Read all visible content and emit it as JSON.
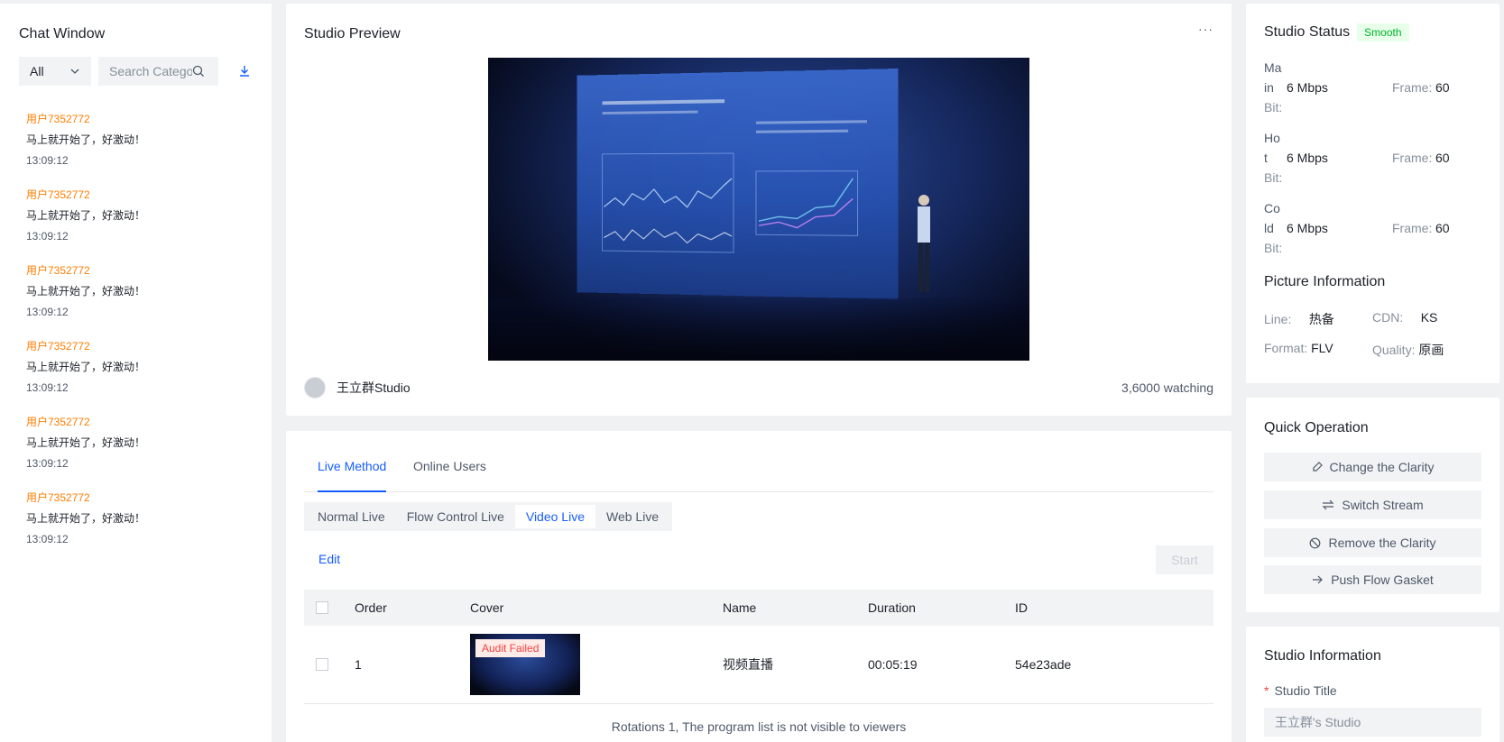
{
  "chat": {
    "title": "Chat Window",
    "filter_value": "All",
    "search_placeholder": "Search Category",
    "messages": [
      {
        "user": "用户7352772",
        "text": "马上就开始了，好激动！",
        "time": "13:09:12"
      },
      {
        "user": "用户7352772",
        "text": "马上就开始了，好激动！",
        "time": "13:09:12"
      },
      {
        "user": "用户7352772",
        "text": "马上就开始了，好激动！",
        "time": "13:09:12"
      },
      {
        "user": "用户7352772",
        "text": "马上就开始了，好激动！",
        "time": "13:09:12"
      },
      {
        "user": "用户7352772",
        "text": "马上就开始了，好激动！",
        "time": "13:09:12"
      },
      {
        "user": "用户7352772",
        "text": "马上就开始了，好激动！",
        "time": "13:09:12"
      }
    ]
  },
  "preview": {
    "title": "Studio Preview",
    "more": "···",
    "streamer_name": "王立群Studio",
    "watching": "3,6000 watching"
  },
  "method": {
    "tabs": [
      "Live Method",
      "Online Users"
    ],
    "active_tab": "Live Method",
    "modes": [
      "Normal Live",
      "Flow Control Live",
      "Video Live",
      "Web Live"
    ],
    "active_mode": "Video Live",
    "edit_label": "Edit",
    "start_label": "Start",
    "columns": [
      "Order",
      "Cover",
      "Name",
      "Duration",
      "ID"
    ],
    "rows": [
      {
        "order": "1",
        "cover_tag": "Audit Failed",
        "name": "视频直播",
        "duration": "00:05:19",
        "id": "54e23ade"
      }
    ],
    "footer": "Rotations 1, The program list is not visible to viewers"
  },
  "status": {
    "title": "Studio Status",
    "badge": "Smooth",
    "streams": [
      {
        "label_a": "Ma",
        "label_b": "in",
        "bit": "Bit:",
        "rate": "6 Mbps",
        "frame_label": "Frame:",
        "frame": "60"
      },
      {
        "label_a": "Ho",
        "label_b": "t",
        "bit": "Bit:",
        "rate": "6 Mbps",
        "frame_label": "Frame:",
        "frame": "60"
      },
      {
        "label_a": "Co",
        "label_b": "ld",
        "bit": "Bit:",
        "rate": "6 Mbps",
        "frame_label": "Frame:",
        "frame": "60"
      }
    ],
    "picture_title": "Picture Information",
    "line_label": "Line:",
    "line": "热备",
    "cdn_label": "CDN:",
    "cdn": "KS",
    "format_label": "Format:",
    "format": "FLV",
    "quality_label": "Quality:",
    "quality": "原画"
  },
  "quick": {
    "title": "Quick Operation",
    "buttons": [
      "Change the Clarity",
      "Switch Stream",
      "Remove the Clarity",
      "Push Flow Gasket"
    ]
  },
  "info": {
    "title": "Studio Information",
    "field_label": "Studio Title",
    "field_value": "王立群's Studio"
  },
  "colors": {
    "primary": "#165dff",
    "user": "#ff7d00",
    "success": "#00b42a",
    "danger": "#f53f3f"
  }
}
